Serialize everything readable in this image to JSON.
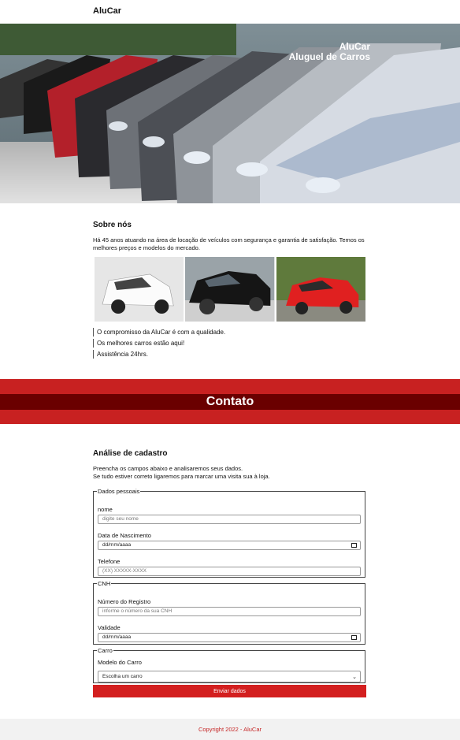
{
  "header": {
    "brand": "AluCar"
  },
  "hero": {
    "line1": "AluCar",
    "line2": "Aluguel de Carros"
  },
  "about": {
    "title": "Sobre nós",
    "text": "Há 45 anos atuando na área de locação de veículos com segurança e garantia de satisfação. Temos os melhores preços e modelos do mercado.",
    "features": [
      "O compromisso da AluCar é com a qualidade.",
      "Os melhores carros estão aqui!",
      "Assistência 24hrs."
    ]
  },
  "banner": {
    "title": "Contato"
  },
  "form": {
    "title": "Análise de cadastro",
    "desc1": "Preencha os campos abaixo e analisaremos seus dados.",
    "desc2": "Se tudo estiver correto ligaremos para marcar uma visita sua à loja.",
    "personal": {
      "legend": "Dados pessoais",
      "name_label": "nome",
      "name_placeholder": "digite seu nome",
      "birth_label": "Data de Nascimento",
      "birth_value": "dd/mm/aaaa",
      "phone_label": "Telefone",
      "phone_placeholder": "(XX) XXXXX-XXXX"
    },
    "cnh": {
      "legend": "CNH",
      "reg_label": "Número do Registro",
      "reg_placeholder": "informe o número da sua CNH",
      "valid_label": "Validade",
      "valid_value": "dd/mm/aaaa"
    },
    "car": {
      "legend": "Carro",
      "model_label": "Modelo do Carro",
      "model_selected": "Escolha um carro"
    },
    "submit": "Enviar dados"
  },
  "footer": {
    "text": "Copyright 2022 - AluCar"
  }
}
